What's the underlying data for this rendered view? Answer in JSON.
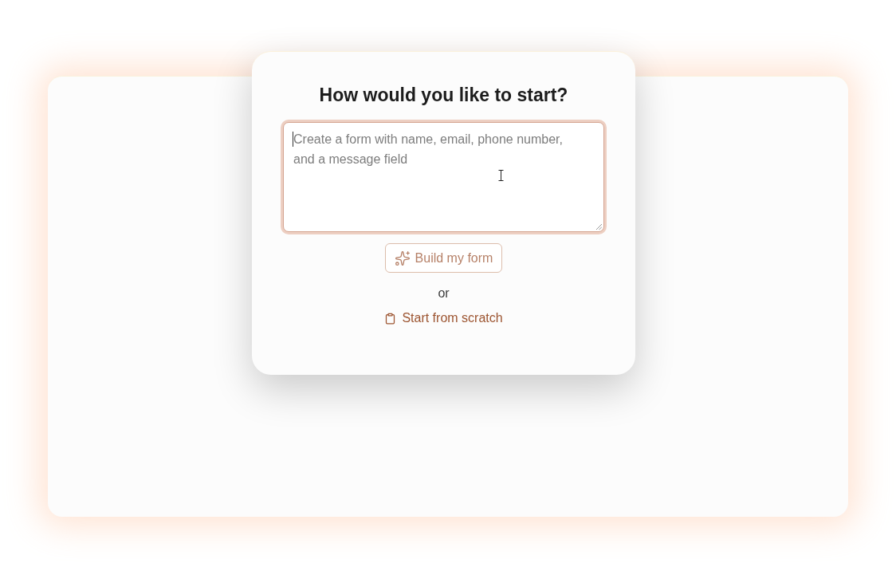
{
  "dialog": {
    "title": "How would you like to start?",
    "prompt_field": {
      "placeholder": "Create a form with name, email, phone number, and a message field",
      "focused": true
    },
    "build_button": {
      "label": "Build my form"
    },
    "separator": "or",
    "scratch_link": {
      "label": "Start from scratch"
    }
  }
}
